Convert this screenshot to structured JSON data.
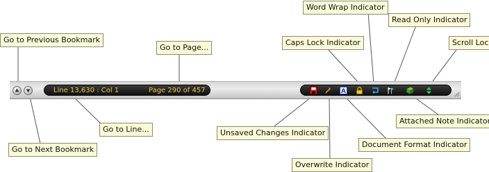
{
  "callouts": {
    "prev_bookmark": "Go to Previous Bookmark",
    "next_bookmark": "Go to Next Bookmark",
    "go_to_line": "Go to Line...",
    "go_to_page": "Go to Page...",
    "word_wrap": "Word Wrap Indicator",
    "caps_lock": "Caps Lock Indicator",
    "read_only": "Read Only Indicator",
    "scroll_lock": "Scroll Lock",
    "unsaved_changes": "Unsaved Changes Indicator",
    "overwrite": "Overwrite Indicator",
    "document_format": "Document Format Indicator",
    "attached_note": "Attached Note Indicator"
  },
  "statusbar": {
    "line_col": "Line 13,630 : Col 1",
    "page": "Page 290 of 457"
  },
  "icons": {
    "prev_bookmark": "arrow-up-icon",
    "next_bookmark": "arrow-down-icon",
    "unsaved_changes": "floppy-disk-icon",
    "overwrite": "pencil-icon",
    "document_format": "document-format-icon",
    "caps_lock": "lock-icon",
    "word_wrap": "wrap-arrow-icon",
    "read_only": "read-only-flag-icon",
    "attached_note": "note-icon",
    "scroll_lock": "scroll-arrows-icon"
  },
  "colors": {
    "callout_bg": "#fbfad8",
    "pill_text": "#e8c84a",
    "pill_bg": "#111111"
  }
}
